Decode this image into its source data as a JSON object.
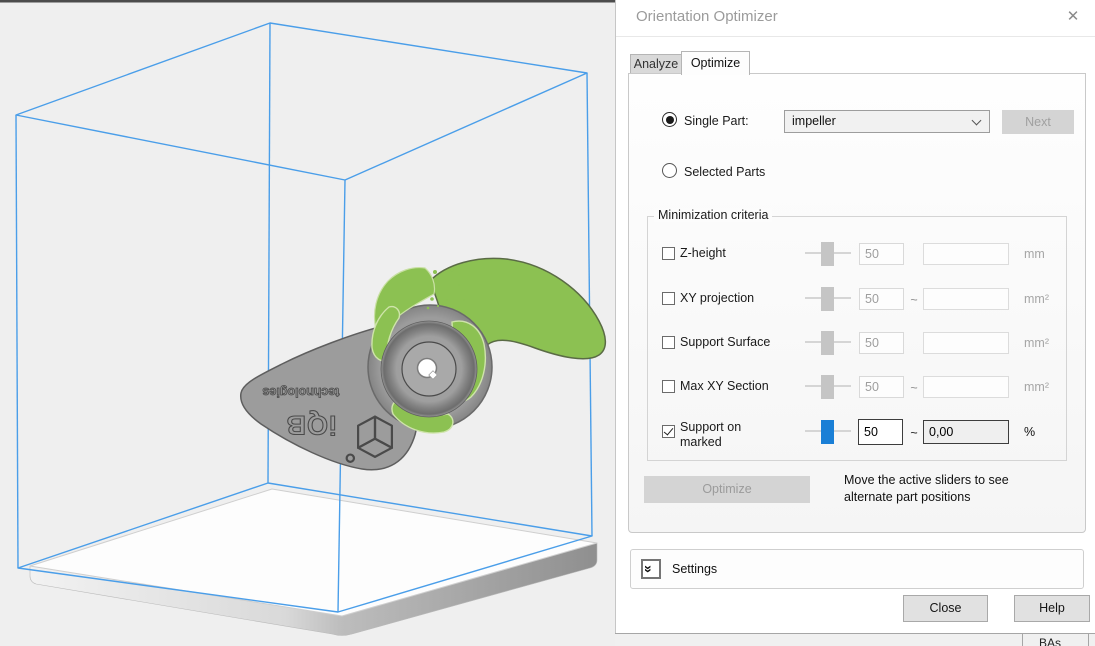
{
  "viewport": {
    "part_logo_line1": "iQB",
    "part_logo_line2": "technologies",
    "colors": {
      "wireframe_blue": "#4a9ee9",
      "marked_green": "#8cc152",
      "part_gray": "#9c9c9c",
      "active_slider_blue": "#1a7fd6"
    }
  },
  "icons": {
    "close": "✕",
    "settings_chevrons": "»"
  },
  "dialog": {
    "title": "Orientation Optimizer",
    "tabs": {
      "analyze": "Analyze",
      "optimize": "Optimize"
    },
    "single_part_label": "Single Part:",
    "selected_parts_label": "Selected Parts",
    "dropdown_value": "impeller",
    "next_label": "Next",
    "criteria_group": {
      "label": "Minimization criteria",
      "rows": [
        {
          "label": "Z-height",
          "checked": false,
          "enabled": false,
          "slider_value": 50,
          "value": "50",
          "tilde": "",
          "value2": "",
          "unit": "mm"
        },
        {
          "label": "XY projection",
          "checked": false,
          "enabled": false,
          "slider_value": 50,
          "value": "50",
          "tilde": "~",
          "value2": "",
          "unit": "mm²"
        },
        {
          "label": "Support Surface",
          "checked": false,
          "enabled": false,
          "slider_value": 50,
          "value": "50",
          "tilde": "",
          "value2": "",
          "unit": "mm²"
        },
        {
          "label": "Max XY Section",
          "checked": false,
          "enabled": false,
          "slider_value": 50,
          "value": "50",
          "tilde": "~",
          "value2": "",
          "unit": "mm²"
        },
        {
          "label": "Support on marked",
          "checked": true,
          "enabled": true,
          "slider_value": 50,
          "value": "50",
          "tilde": "~",
          "value2": "0,00",
          "unit": "%"
        }
      ]
    },
    "optimize_button": "Optimize",
    "hint_line1": "Move the active sliders to see",
    "hint_line2": "alternate part positions",
    "settings_label": "Settings",
    "close_button": "Close",
    "help_button": "Help"
  },
  "statusbar": {
    "partial_text": "BAs"
  }
}
